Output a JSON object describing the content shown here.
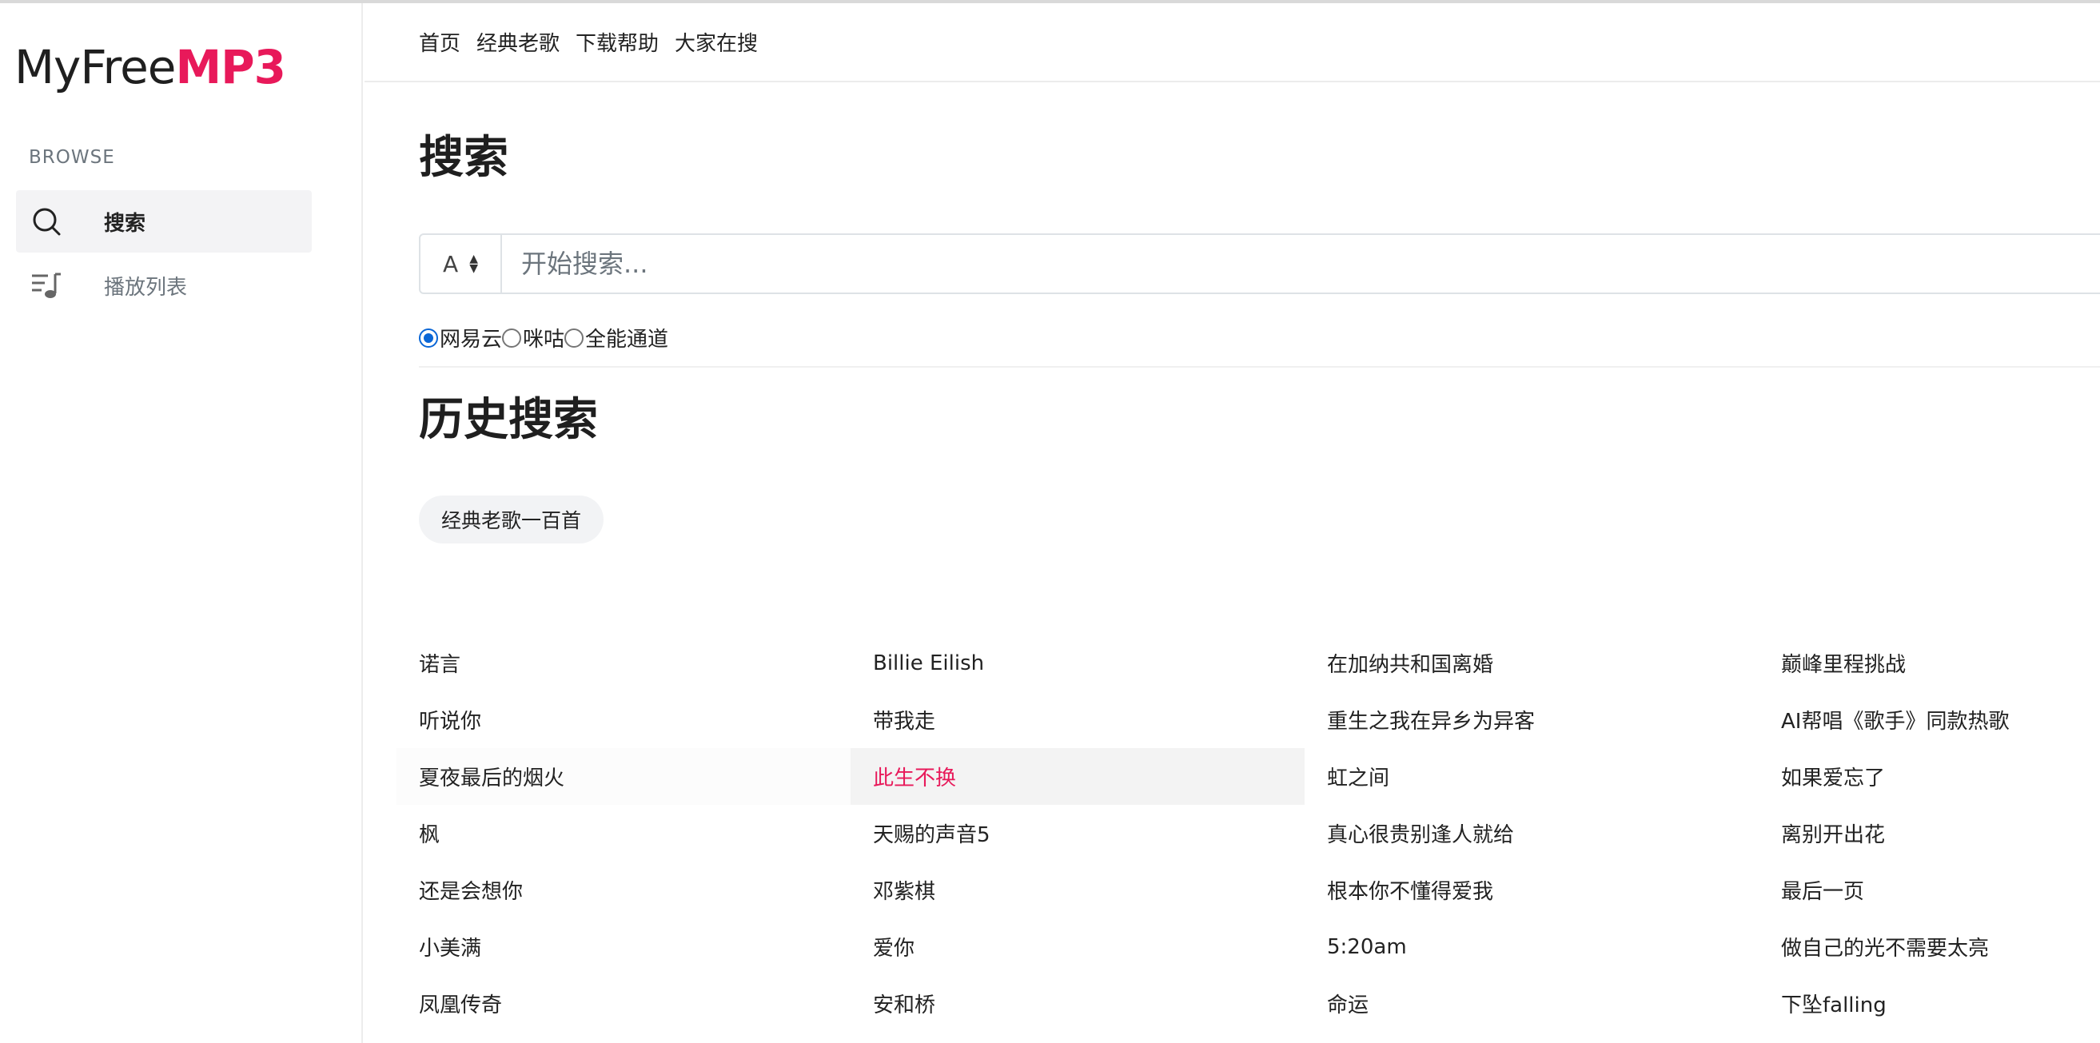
{
  "brand": {
    "name_prefix": "MyFree",
    "name_accent": "MP3",
    "accent_color": "#e8195a"
  },
  "sidebar": {
    "section_label": "BROWSE",
    "items": [
      {
        "label": "搜索",
        "icon": "search-icon",
        "active": true
      },
      {
        "label": "播放列表",
        "icon": "playlist-icon",
        "active": false
      }
    ]
  },
  "topnav": {
    "links": [
      "首页",
      "经典老歌",
      "下载帮助",
      "大家在搜"
    ]
  },
  "search": {
    "title": "搜索",
    "mode_selected": "A",
    "placeholder": "开始搜索...",
    "value": "",
    "sources": [
      {
        "label": "网易云",
        "checked": true
      },
      {
        "label": "咪咕",
        "checked": false
      },
      {
        "label": "全能通道",
        "checked": false
      }
    ]
  },
  "history": {
    "title": "历史搜索",
    "chips": [
      "经典老歌一百首"
    ]
  },
  "hot_searches": {
    "columns": [
      [
        "诺言",
        "听说你",
        "夏夜最后的烟火",
        "枫",
        "还是会想你",
        "小美满",
        "凤凰传奇"
      ],
      [
        "Billie Eilish",
        "带我走",
        "此生不换",
        "天赐的声音5",
        "邓紫棋",
        "爱你",
        "安和桥"
      ],
      [
        "在加纳共和国离婚",
        "重生之我在异乡为异客",
        "虹之间",
        "真心很贵别逢人就给",
        "根本你不懂得爱我",
        "5:20am",
        "命运"
      ],
      [
        "巅峰里程挑战",
        "AI帮唱《歌手》同款热歌",
        "如果爱忘了",
        "离别开出花",
        "最后一页",
        "做自己的光不需要太亮",
        "下坠falling"
      ]
    ],
    "highlighted": "此生不换"
  }
}
